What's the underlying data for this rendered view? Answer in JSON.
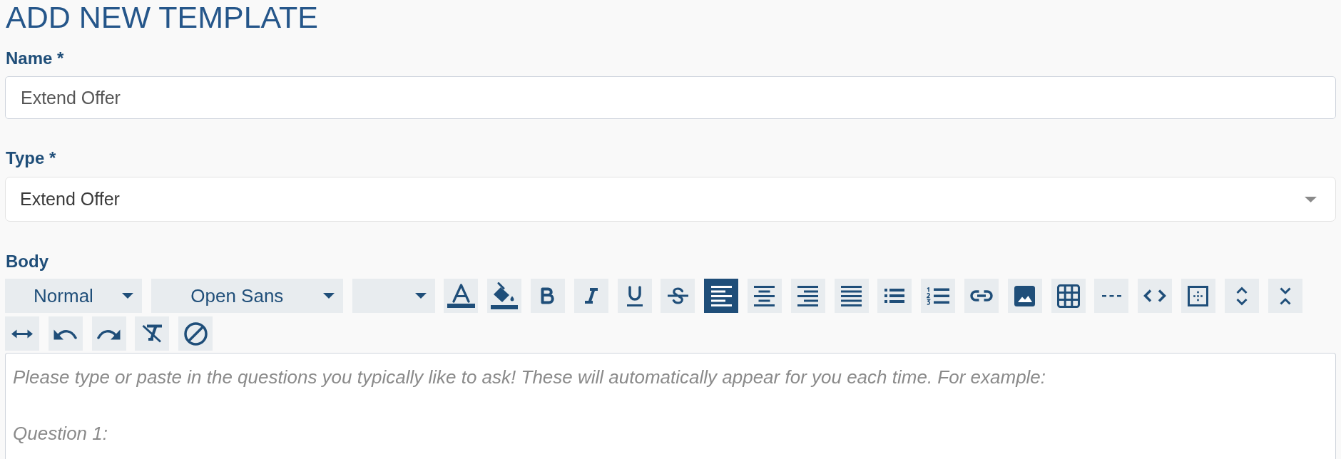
{
  "title": "ADD NEW TEMPLATE",
  "fields": [
    {
      "kind": "text",
      "label": "Name *",
      "value": "Extend Offer"
    },
    {
      "kind": "select",
      "label": "Type *",
      "value": "Extend Offer"
    }
  ],
  "body": {
    "label": "Body",
    "toolbar": [
      {
        "kind": "dropdown",
        "value": "Normal"
      },
      {
        "kind": "dropdown",
        "value": "Open Sans"
      },
      {
        "kind": "dropdown"
      },
      {
        "kind": "button",
        "selected": false
      },
      {
        "kind": "button",
        "selected": false
      },
      {
        "kind": "button",
        "selected": false
      },
      {
        "kind": "button",
        "selected": false
      },
      {
        "kind": "button",
        "selected": false
      },
      {
        "kind": "button",
        "selected": false
      },
      {
        "kind": "button",
        "selected": true
      },
      {
        "kind": "button",
        "selected": false
      },
      {
        "kind": "button",
        "selected": false
      },
      {
        "kind": "button",
        "selected": false
      },
      {
        "kind": "button",
        "selected": false
      },
      {
        "kind": "button",
        "selected": false
      },
      {
        "kind": "button",
        "selected": false
      },
      {
        "kind": "button",
        "selected": false
      },
      {
        "kind": "button",
        "selected": false
      },
      {
        "kind": "button",
        "selected": false
      },
      {
        "kind": "button",
        "selected": false
      },
      {
        "kind": "button",
        "selected": false
      },
      {
        "kind": "button",
        "selected": false
      },
      {
        "kind": "button",
        "selected": false
      },
      {
        "kind": "button",
        "selected": false
      },
      {
        "kind": "button",
        "selected": false
      },
      {
        "kind": "button",
        "selected": false
      },
      {
        "kind": "button",
        "selected": false
      },
      {
        "kind": "button",
        "selected": false
      }
    ],
    "paragraphs": [
      "Please type or paste in the questions you typically like to ask! These will automatically appear for you each time. For example:",
      "Question 1:"
    ]
  }
}
